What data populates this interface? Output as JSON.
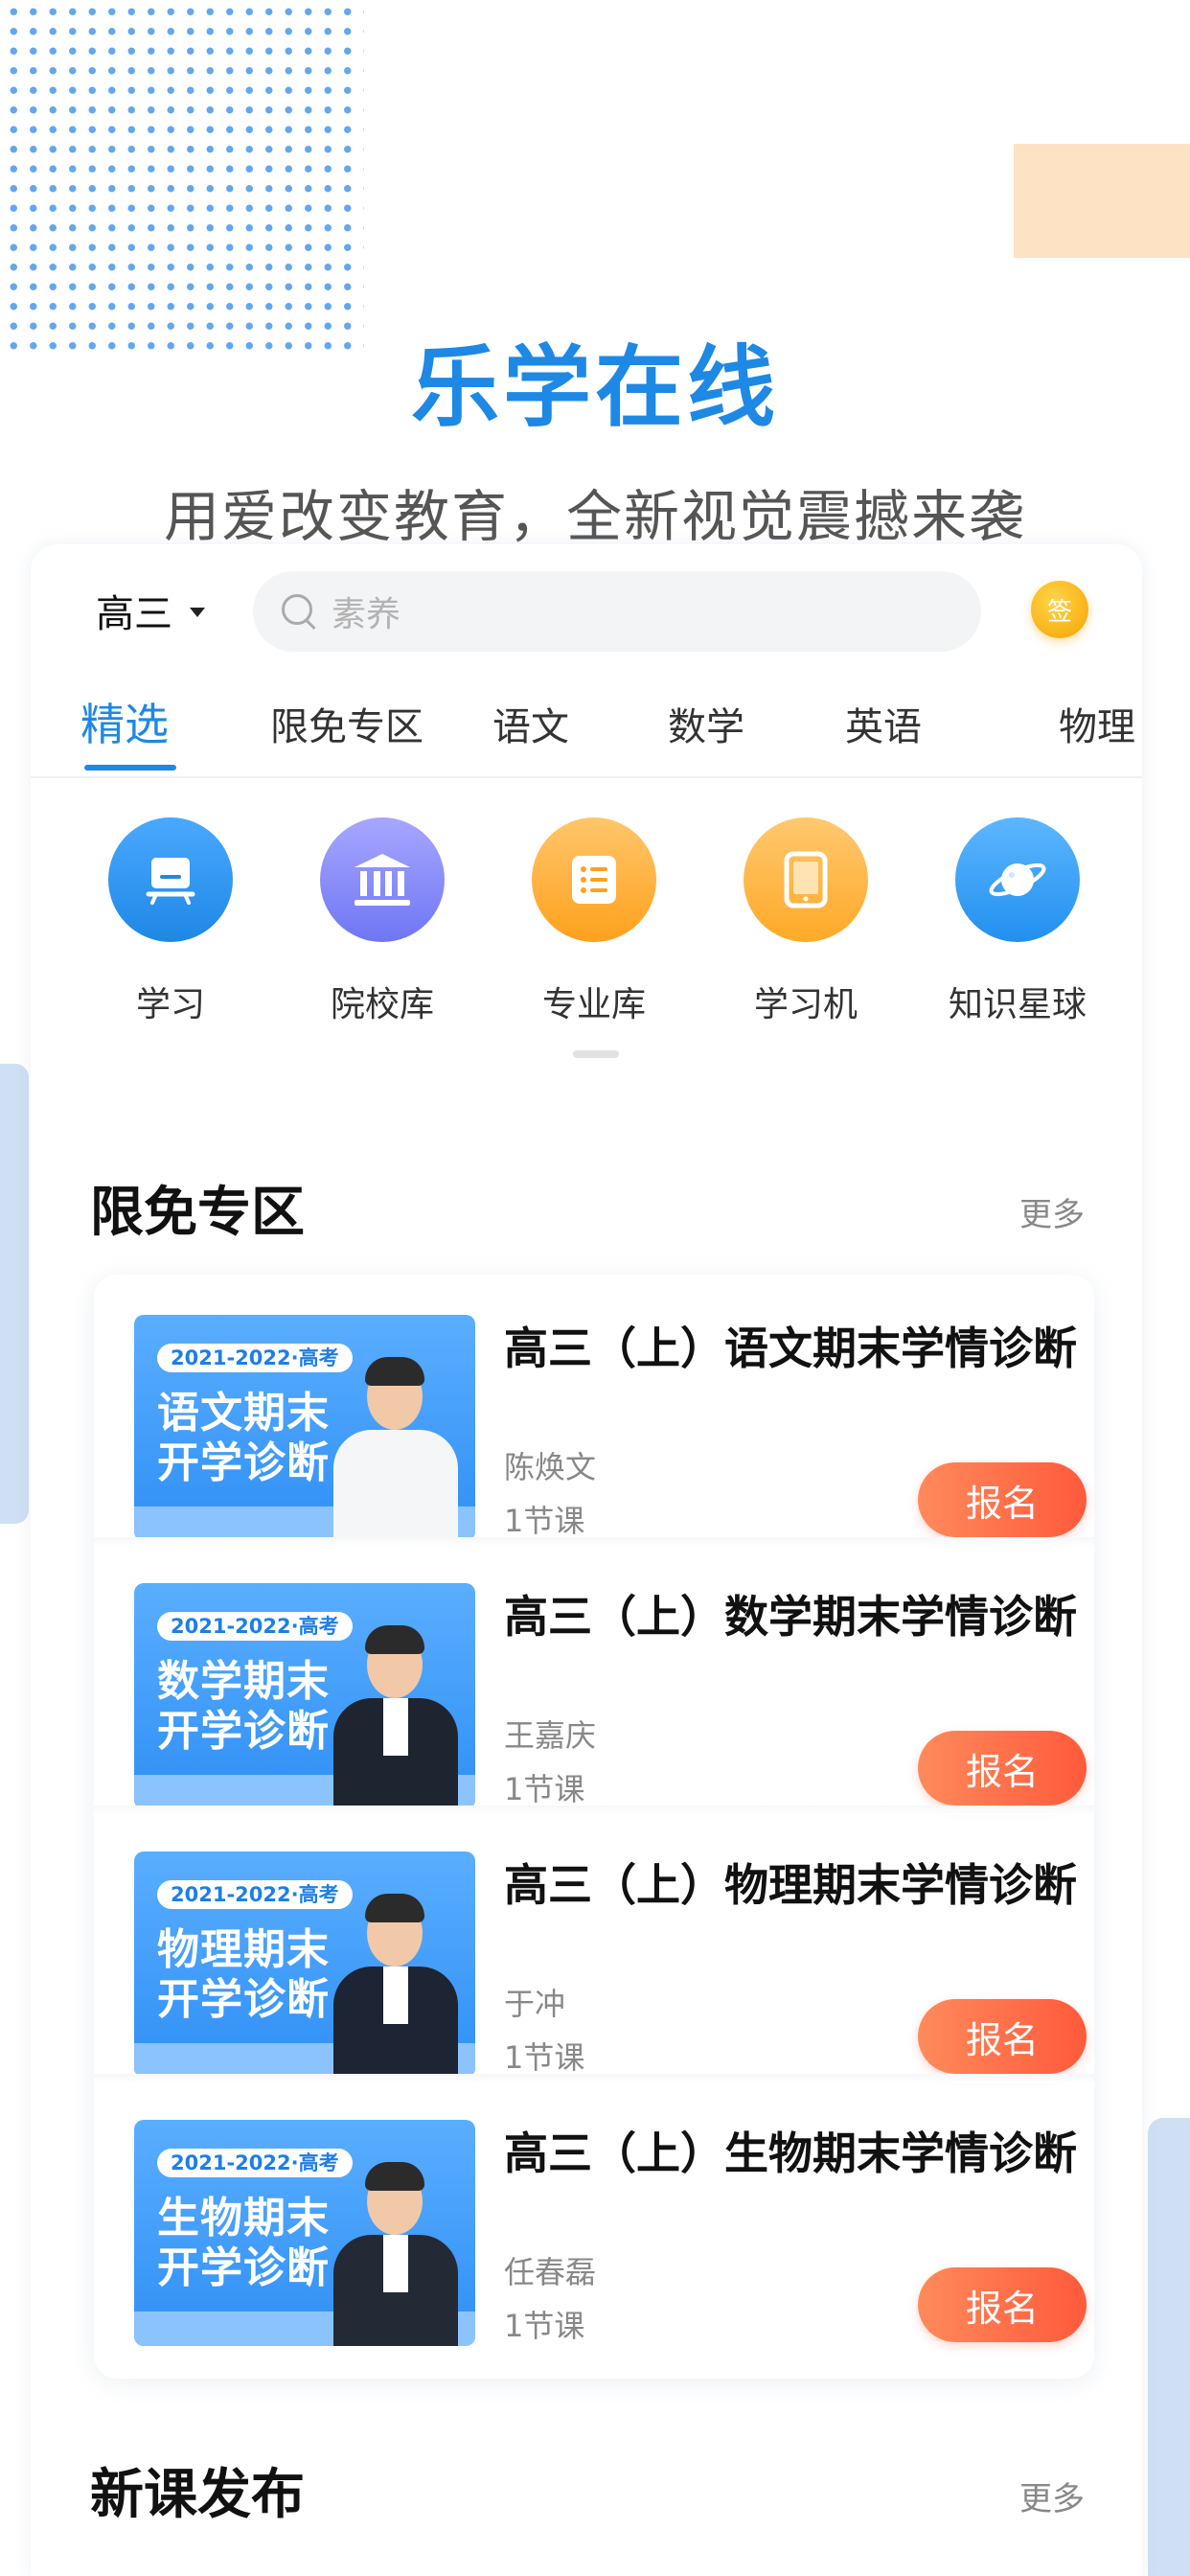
{
  "hero": {
    "title": "乐学在线",
    "subtitle": "用爱改变教育，全新视觉震撼来袭"
  },
  "header": {
    "grade": "高三",
    "search_placeholder": "素养",
    "sign_label": "签"
  },
  "tabs": [
    "精选",
    "限免专区",
    "语文",
    "数学",
    "英语",
    "物理"
  ],
  "quick_entries": [
    {
      "label": "学习",
      "icon": "study-icon"
    },
    {
      "label": "院校库",
      "icon": "university-icon"
    },
    {
      "label": "专业库",
      "icon": "major-list-icon"
    },
    {
      "label": "学习机",
      "icon": "tablet-icon"
    },
    {
      "label": "知识星球",
      "icon": "planet-icon"
    }
  ],
  "free_section": {
    "title": "限免专区",
    "more": "更多",
    "courses": [
      {
        "thumb_tag": "2021-2022·高考",
        "thumb_line1": "语文期末",
        "thumb_line2": "开学诊断",
        "title": "高三（上）语文期末学情诊断",
        "teacher": "陈焕文",
        "lessons": "1节课",
        "button": "报名"
      },
      {
        "thumb_tag": "2021-2022·高考",
        "thumb_line1": "数学期末",
        "thumb_line2": "开学诊断",
        "title": "高三（上）数学期末学情诊断",
        "teacher": "王嘉庆",
        "lessons": "1节课",
        "button": "报名"
      },
      {
        "thumb_tag": "2021-2022·高考",
        "thumb_line1": "物理期末",
        "thumb_line2": "开学诊断",
        "title": "高三（上）物理期末学情诊断",
        "teacher": "于冲",
        "lessons": "1节课",
        "button": "报名"
      },
      {
        "thumb_tag": "2021-2022·高考",
        "thumb_line1": "生物期末",
        "thumb_line2": "开学诊断",
        "title": "高三（上）生物期末学情诊断",
        "teacher": "任春磊",
        "lessons": "1节课",
        "button": "报名"
      }
    ]
  },
  "new_section": {
    "title": "新课发布",
    "more": "更多"
  },
  "colors": {
    "accent": "#1e88e5",
    "button": "#ff6a48",
    "peach": "#fde2c3"
  }
}
